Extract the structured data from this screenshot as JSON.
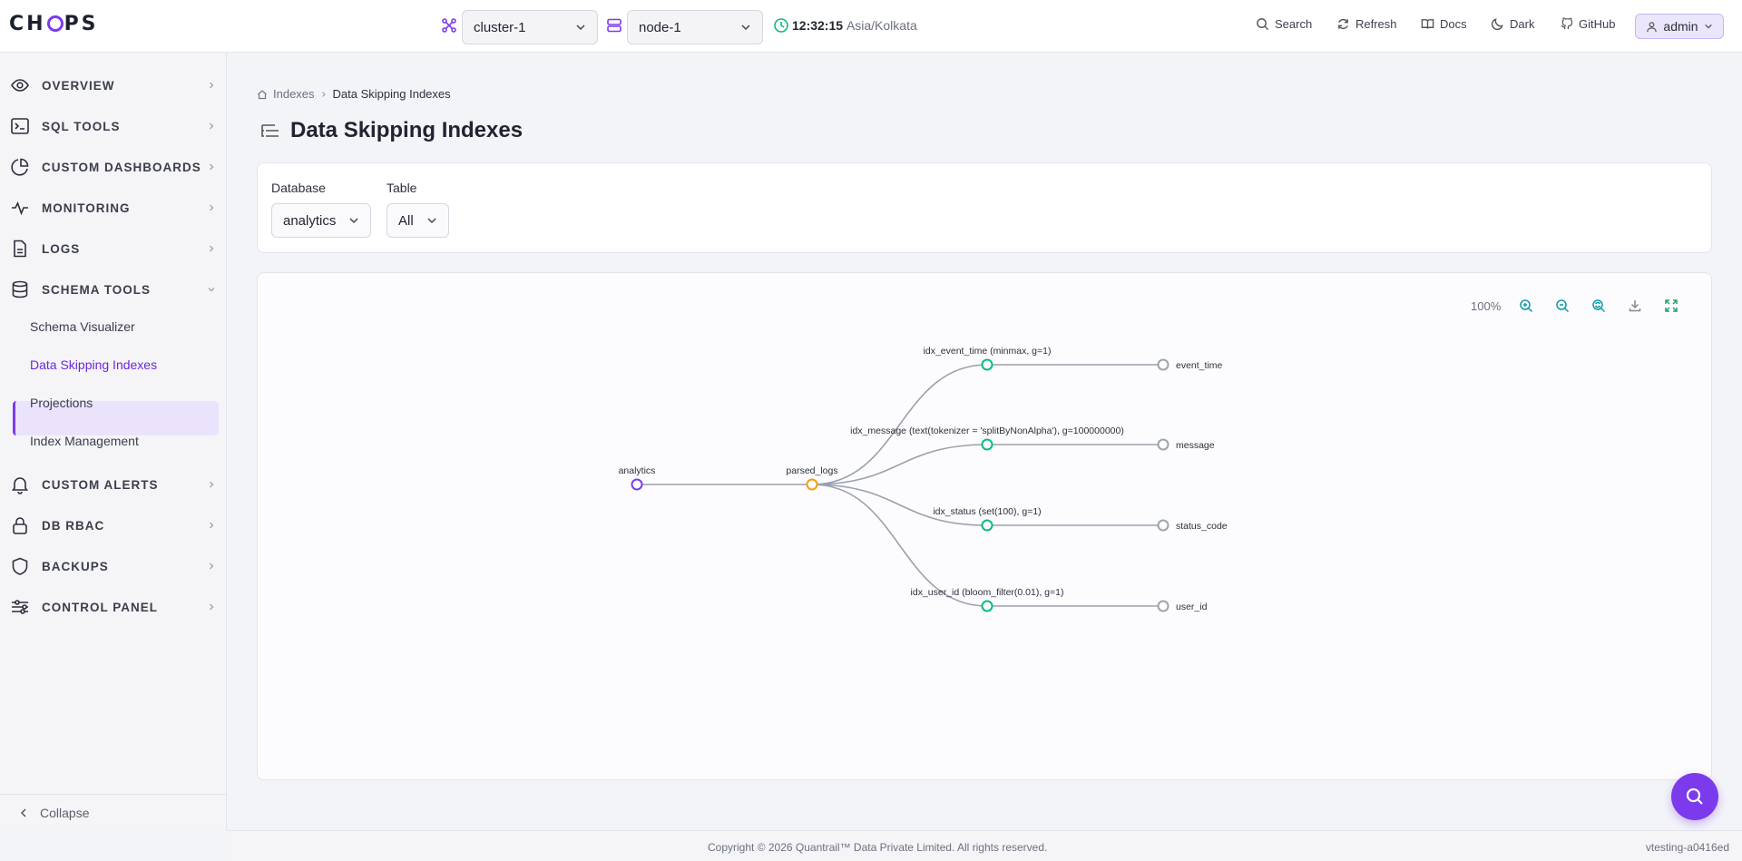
{
  "app": {
    "logo": "CHOPS"
  },
  "header": {
    "cluster": "cluster-1",
    "node": "node-1",
    "time": "12:32:15",
    "timezone": "Asia/Kolkata",
    "actions": {
      "search": "Search",
      "refresh": "Refresh",
      "docs": "Docs",
      "dark": "Dark",
      "github": "GitHub"
    },
    "user": "admin"
  },
  "sidebar": {
    "items": [
      {
        "label": "OVERVIEW",
        "icon": "eye-icon"
      },
      {
        "label": "SQL TOOLS",
        "icon": "terminal-icon"
      },
      {
        "label": "CUSTOM DASHBOARDS",
        "icon": "pie-chart-icon"
      },
      {
        "label": "MONITORING",
        "icon": "activity-icon"
      },
      {
        "label": "LOGS",
        "icon": "file-icon"
      },
      {
        "label": "SCHEMA TOOLS",
        "icon": "database-icon"
      },
      {
        "label": "CUSTOM ALERTS",
        "icon": "bell-icon"
      },
      {
        "label": "DB RBAC",
        "icon": "lock-icon"
      },
      {
        "label": "BACKUPS",
        "icon": "shield-icon"
      },
      {
        "label": "CONTROL PANEL",
        "icon": "sliders-icon"
      }
    ],
    "schema_subitems": [
      "Schema Visualizer",
      "Data Skipping Indexes",
      "Projections",
      "Index Management"
    ],
    "collapse": "Collapse"
  },
  "breadcrumb": {
    "parent": "Indexes",
    "current": "Data Skipping Indexes"
  },
  "page": {
    "title": "Data Skipping Indexes"
  },
  "filters": {
    "database_label": "Database",
    "database_value": "analytics",
    "table_label": "Table",
    "table_value": "All"
  },
  "graph": {
    "zoom": "100%",
    "database": "analytics",
    "table": "parsed_logs",
    "indexes": [
      {
        "label": "idx_event_time (minmax, g=1)",
        "column": "event_time"
      },
      {
        "label": "idx_message (text(tokenizer = 'splitByNonAlpha'), g=100000000)",
        "column": "message"
      },
      {
        "label": "idx_status (set(100), g=1)",
        "column": "status_code"
      },
      {
        "label": "idx_user_id (bloom_filter(0.01), g=1)",
        "column": "user_id"
      }
    ]
  },
  "footer": {
    "copyright": "Copyright © 2026 Quantrail™ Data Private Limited. All rights reserved.",
    "version": "vtesting-a0416ed"
  },
  "colors": {
    "accent": "#7c3aed",
    "table_node": "#f59e0b",
    "index_node": "#10b981",
    "column_node": "#9ca3af"
  }
}
